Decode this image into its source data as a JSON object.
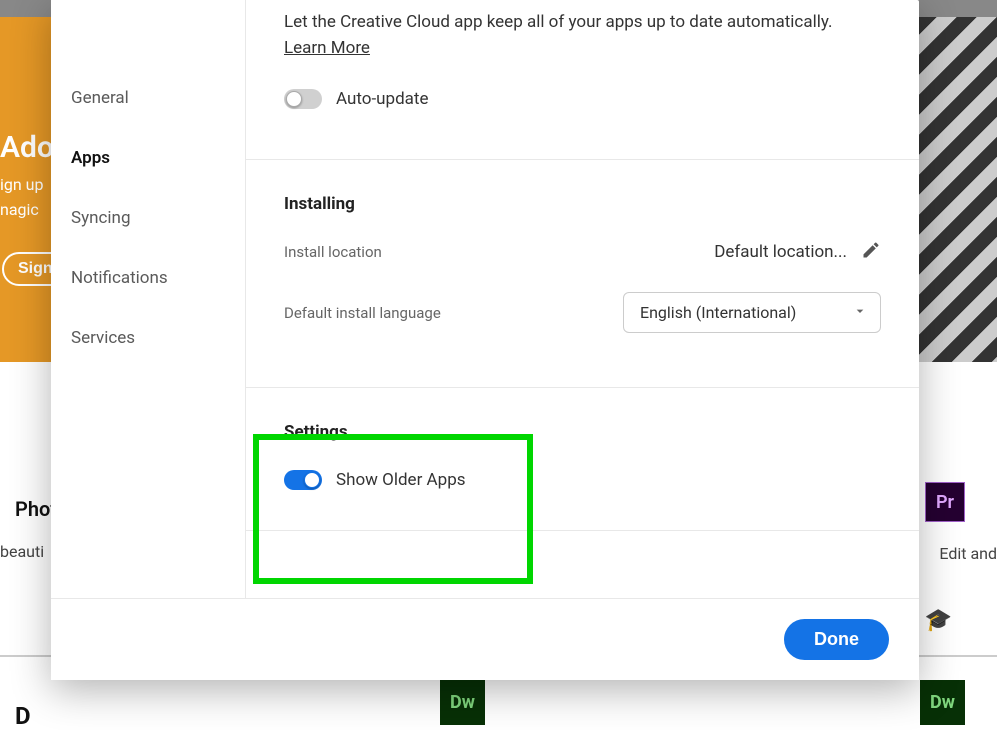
{
  "background": {
    "brand": "Adob",
    "sub1": "ign up",
    "sub2": "nagic",
    "signup": "Sign",
    "phot": "Phot",
    "beau": "beauti",
    "edit": "Edit and",
    "pr": "Pr",
    "grad": "🎓",
    "dw": "Dw",
    "p_fragment": "D"
  },
  "sidebar": {
    "items": [
      {
        "label": "General"
      },
      {
        "label": "Apps"
      },
      {
        "label": "Syncing"
      },
      {
        "label": "Notifications"
      },
      {
        "label": "Services"
      }
    ]
  },
  "update_section": {
    "description": "Let the Creative Cloud app keep all of your apps up to date automatically.",
    "learn_more": "Learn More",
    "auto_update_label": "Auto-update"
  },
  "installing_section": {
    "heading": "Installing",
    "install_location_label": "Install location",
    "install_location_value": "Default location...",
    "language_label": "Default install language",
    "language_value": "English (International)"
  },
  "settings_section": {
    "heading": "Settings",
    "show_older_label": "Show Older Apps"
  },
  "footer": {
    "done": "Done"
  }
}
